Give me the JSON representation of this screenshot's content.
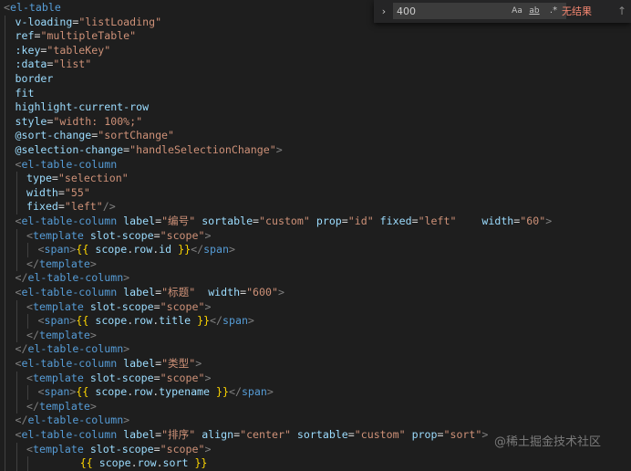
{
  "find": {
    "query": "400",
    "toggle_icon": "chevron-right-icon",
    "match_case_label": "Aa",
    "whole_word_label": "ab",
    "regex_label": ".*",
    "result_text": "无结果",
    "prev_icon": "arrow-up-icon"
  },
  "watermark": "@稀土掘金技术社区",
  "colors": {
    "background": "#1e1e1e",
    "tag": "#569cd6",
    "attribute": "#9cdcfe",
    "string": "#ce9178",
    "bracket": "#808080",
    "mustache": "#ffd700",
    "no_results": "#f48771"
  },
  "code_lines": [
    [
      [
        "b",
        "<"
      ],
      [
        "g",
        "el-table"
      ]
    ],
    [
      [
        "a",
        "v-loading"
      ],
      [
        "t",
        "="
      ],
      [
        "s",
        "\"listLoading\""
      ]
    ],
    [
      [
        "a",
        "ref"
      ],
      [
        "t",
        "="
      ],
      [
        "s",
        "\"multipleTable\""
      ]
    ],
    [
      [
        "a",
        ":key"
      ],
      [
        "t",
        "="
      ],
      [
        "s",
        "\"tableKey\""
      ]
    ],
    [
      [
        "a",
        ":data"
      ],
      [
        "t",
        "="
      ],
      [
        "s",
        "\"list\""
      ]
    ],
    [
      [
        "a",
        "border"
      ]
    ],
    [
      [
        "a",
        "fit"
      ]
    ],
    [
      [
        "a",
        "highlight-current-row"
      ]
    ],
    [
      [
        "a",
        "style"
      ],
      [
        "t",
        "="
      ],
      [
        "s",
        "\"width: 100%;\""
      ]
    ],
    [
      [
        "a",
        "@sort-change"
      ],
      [
        "t",
        "="
      ],
      [
        "s",
        "\"sortChange\""
      ]
    ],
    [
      [
        "a",
        "@selection-change"
      ],
      [
        "t",
        "="
      ],
      [
        "s",
        "\"handleSelectionChange\""
      ],
      [
        "b",
        ">"
      ]
    ],
    [
      [
        "b",
        "<"
      ],
      [
        "g",
        "el-table-column"
      ]
    ],
    [
      [
        "a",
        "type"
      ],
      [
        "t",
        "="
      ],
      [
        "s",
        "\"selection\""
      ]
    ],
    [
      [
        "a",
        "width"
      ],
      [
        "t",
        "="
      ],
      [
        "s",
        "\"55\""
      ]
    ],
    [
      [
        "a",
        "fixed"
      ],
      [
        "t",
        "="
      ],
      [
        "s",
        "\"left\""
      ],
      [
        "b",
        "/>"
      ]
    ],
    [
      [
        "b",
        "<"
      ],
      [
        "g",
        "el-table-column"
      ],
      [
        "t",
        " "
      ],
      [
        "a",
        "label"
      ],
      [
        "t",
        "="
      ],
      [
        "s",
        "\"编号\""
      ],
      [
        "t",
        " "
      ],
      [
        "a",
        "sortable"
      ],
      [
        "t",
        "="
      ],
      [
        "s",
        "\"custom\""
      ],
      [
        "t",
        " "
      ],
      [
        "a",
        "prop"
      ],
      [
        "t",
        "="
      ],
      [
        "s",
        "\"id\""
      ],
      [
        "t",
        " "
      ],
      [
        "a",
        "fixed"
      ],
      [
        "t",
        "="
      ],
      [
        "s",
        "\"left\""
      ],
      [
        "t",
        "    "
      ],
      [
        "a",
        "width"
      ],
      [
        "t",
        "="
      ],
      [
        "s",
        "\"60\""
      ],
      [
        "b",
        ">"
      ]
    ],
    [
      [
        "b",
        "<"
      ],
      [
        "g",
        "template"
      ],
      [
        "t",
        " "
      ],
      [
        "a",
        "slot-scope"
      ],
      [
        "t",
        "="
      ],
      [
        "s",
        "\"scope\""
      ],
      [
        "b",
        ">"
      ]
    ],
    [
      [
        "b",
        "<"
      ],
      [
        "g",
        "span"
      ],
      [
        "b",
        ">"
      ],
      [
        "m",
        "{{"
      ],
      [
        "t",
        " "
      ],
      [
        "e",
        "scope"
      ],
      [
        "t",
        "."
      ],
      [
        "e",
        "row"
      ],
      [
        "t",
        "."
      ],
      [
        "e",
        "id"
      ],
      [
        "t",
        " "
      ],
      [
        "m",
        "}}"
      ],
      [
        "b",
        "</"
      ],
      [
        "g",
        "span"
      ],
      [
        "b",
        ">"
      ]
    ],
    [
      [
        "b",
        "</"
      ],
      [
        "g",
        "template"
      ],
      [
        "b",
        ">"
      ]
    ],
    [
      [
        "b",
        "</"
      ],
      [
        "g",
        "el-table-column"
      ],
      [
        "b",
        ">"
      ]
    ],
    [
      [
        "b",
        "<"
      ],
      [
        "g",
        "el-table-column"
      ],
      [
        "t",
        " "
      ],
      [
        "a",
        "label"
      ],
      [
        "t",
        "="
      ],
      [
        "s",
        "\"标题\""
      ],
      [
        "t",
        "  "
      ],
      [
        "a",
        "width"
      ],
      [
        "t",
        "="
      ],
      [
        "s",
        "\"600\""
      ],
      [
        "b",
        ">"
      ]
    ],
    [
      [
        "b",
        "<"
      ],
      [
        "g",
        "template"
      ],
      [
        "t",
        " "
      ],
      [
        "a",
        "slot-scope"
      ],
      [
        "t",
        "="
      ],
      [
        "s",
        "\"scope\""
      ],
      [
        "b",
        ">"
      ]
    ],
    [
      [
        "b",
        "<"
      ],
      [
        "g",
        "span"
      ],
      [
        "b",
        ">"
      ],
      [
        "m",
        "{{"
      ],
      [
        "t",
        " "
      ],
      [
        "e",
        "scope"
      ],
      [
        "t",
        "."
      ],
      [
        "e",
        "row"
      ],
      [
        "t",
        "."
      ],
      [
        "e",
        "title"
      ],
      [
        "t",
        " "
      ],
      [
        "m",
        "}}"
      ],
      [
        "b",
        "</"
      ],
      [
        "g",
        "span"
      ],
      [
        "b",
        ">"
      ]
    ],
    [
      [
        "b",
        "</"
      ],
      [
        "g",
        "template"
      ],
      [
        "b",
        ">"
      ]
    ],
    [
      [
        "b",
        "</"
      ],
      [
        "g",
        "el-table-column"
      ],
      [
        "b",
        ">"
      ]
    ],
    [
      [
        "b",
        "<"
      ],
      [
        "g",
        "el-table-column"
      ],
      [
        "t",
        " "
      ],
      [
        "a",
        "label"
      ],
      [
        "t",
        "="
      ],
      [
        "s",
        "\"类型\""
      ],
      [
        "b",
        ">"
      ]
    ],
    [
      [
        "b",
        "<"
      ],
      [
        "g",
        "template"
      ],
      [
        "t",
        " "
      ],
      [
        "a",
        "slot-scope"
      ],
      [
        "t",
        "="
      ],
      [
        "s",
        "\"scope\""
      ],
      [
        "b",
        ">"
      ]
    ],
    [
      [
        "b",
        "<"
      ],
      [
        "g",
        "span"
      ],
      [
        "b",
        ">"
      ],
      [
        "m",
        "{{"
      ],
      [
        "t",
        " "
      ],
      [
        "e",
        "scope"
      ],
      [
        "t",
        "."
      ],
      [
        "e",
        "row"
      ],
      [
        "t",
        "."
      ],
      [
        "e",
        "typename"
      ],
      [
        "t",
        " "
      ],
      [
        "m",
        "}}"
      ],
      [
        "b",
        "</"
      ],
      [
        "g",
        "span"
      ],
      [
        "b",
        ">"
      ]
    ],
    [
      [
        "b",
        "</"
      ],
      [
        "g",
        "template"
      ],
      [
        "b",
        ">"
      ]
    ],
    [
      [
        "b",
        "</"
      ],
      [
        "g",
        "el-table-column"
      ],
      [
        "b",
        ">"
      ]
    ],
    [
      [
        "b",
        "<"
      ],
      [
        "g",
        "el-table-column"
      ],
      [
        "t",
        " "
      ],
      [
        "a",
        "label"
      ],
      [
        "t",
        "="
      ],
      [
        "s",
        "\"排序\""
      ],
      [
        "t",
        " "
      ],
      [
        "a",
        "align"
      ],
      [
        "t",
        "="
      ],
      [
        "s",
        "\"center\""
      ],
      [
        "t",
        " "
      ],
      [
        "a",
        "sortable"
      ],
      [
        "t",
        "="
      ],
      [
        "s",
        "\"custom\""
      ],
      [
        "t",
        " "
      ],
      [
        "a",
        "prop"
      ],
      [
        "t",
        "="
      ],
      [
        "s",
        "\"sort\""
      ],
      [
        "b",
        ">"
      ]
    ],
    [
      [
        "b",
        "<"
      ],
      [
        "g",
        "template"
      ],
      [
        "t",
        " "
      ],
      [
        "a",
        "slot-scope"
      ],
      [
        "t",
        "="
      ],
      [
        "s",
        "\"scope\""
      ],
      [
        "b",
        ">"
      ]
    ],
    [
      [
        "t",
        "            "
      ],
      [
        "m",
        "{{"
      ],
      [
        "t",
        " "
      ],
      [
        "e",
        "scope"
      ],
      [
        "t",
        "."
      ],
      [
        "e",
        "row"
      ],
      [
        "t",
        "."
      ],
      [
        "e",
        "sort"
      ],
      [
        "t",
        " "
      ],
      [
        "m",
        "}}"
      ]
    ]
  ]
}
